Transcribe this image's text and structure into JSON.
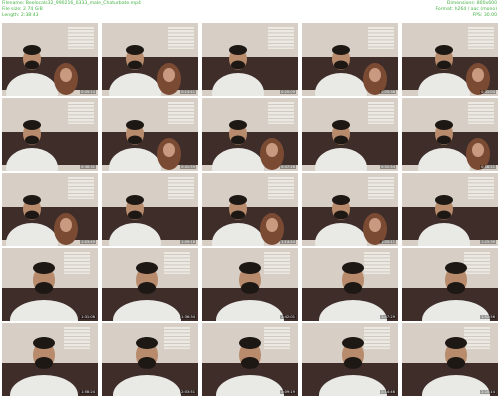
{
  "header": {
    "filename_line": "Filename: Beelocals32_990216_0333_male_Chaturbate.mp4",
    "filesize_line": "File size: 2.74 GiB",
    "length_line": "Length: 2:38:43",
    "dimensions_line": "Dimensions: 800x600",
    "format_line": "Format: h264 / aac (mono)",
    "fps_line": "FPS: 30.00"
  },
  "thumbnails": [
    {
      "time": "0:09:14",
      "scene": "couch"
    },
    {
      "time": "0:14:41",
      "scene": "couch"
    },
    {
      "time": "0:20:09",
      "scene": "couch"
    },
    {
      "time": "0:25:36",
      "scene": "couch"
    },
    {
      "time": "0:31:04",
      "scene": "couch"
    },
    {
      "time": "0:36:31",
      "scene": "couch"
    },
    {
      "time": "0:41:59",
      "scene": "couch"
    },
    {
      "time": "0:47:26",
      "scene": "couch"
    },
    {
      "time": "0:52:54",
      "scene": "couch"
    },
    {
      "time": "0:58:21",
      "scene": "couch"
    },
    {
      "time": "1:03:49",
      "scene": "couch"
    },
    {
      "time": "1:09:16",
      "scene": "couch"
    },
    {
      "time": "1:14:44",
      "scene": "couch"
    },
    {
      "time": "1:20:11",
      "scene": "couch"
    },
    {
      "time": "1:25:39",
      "scene": "couch"
    },
    {
      "time": "1:31:06",
      "scene": "closeup"
    },
    {
      "time": "1:36:34",
      "scene": "closeup"
    },
    {
      "time": "1:42:01",
      "scene": "closeup"
    },
    {
      "time": "1:47:29",
      "scene": "closeup"
    },
    {
      "time": "1:52:56",
      "scene": "closeup"
    },
    {
      "time": "1:58:24",
      "scene": "closeup"
    },
    {
      "time": "2:03:51",
      "scene": "closeup"
    },
    {
      "time": "2:09:19",
      "scene": "closeup"
    },
    {
      "time": "2:14:46",
      "scene": "closeup"
    },
    {
      "time": "2:20:14",
      "scene": "closeup"
    }
  ],
  "colors": {
    "meta_text": "#44b244",
    "wall": "#d7cfc6",
    "couch": "#3f2d2a",
    "shirt": "#e9e9e6",
    "skin": "#b88b6c",
    "hair": "#1e1815"
  }
}
